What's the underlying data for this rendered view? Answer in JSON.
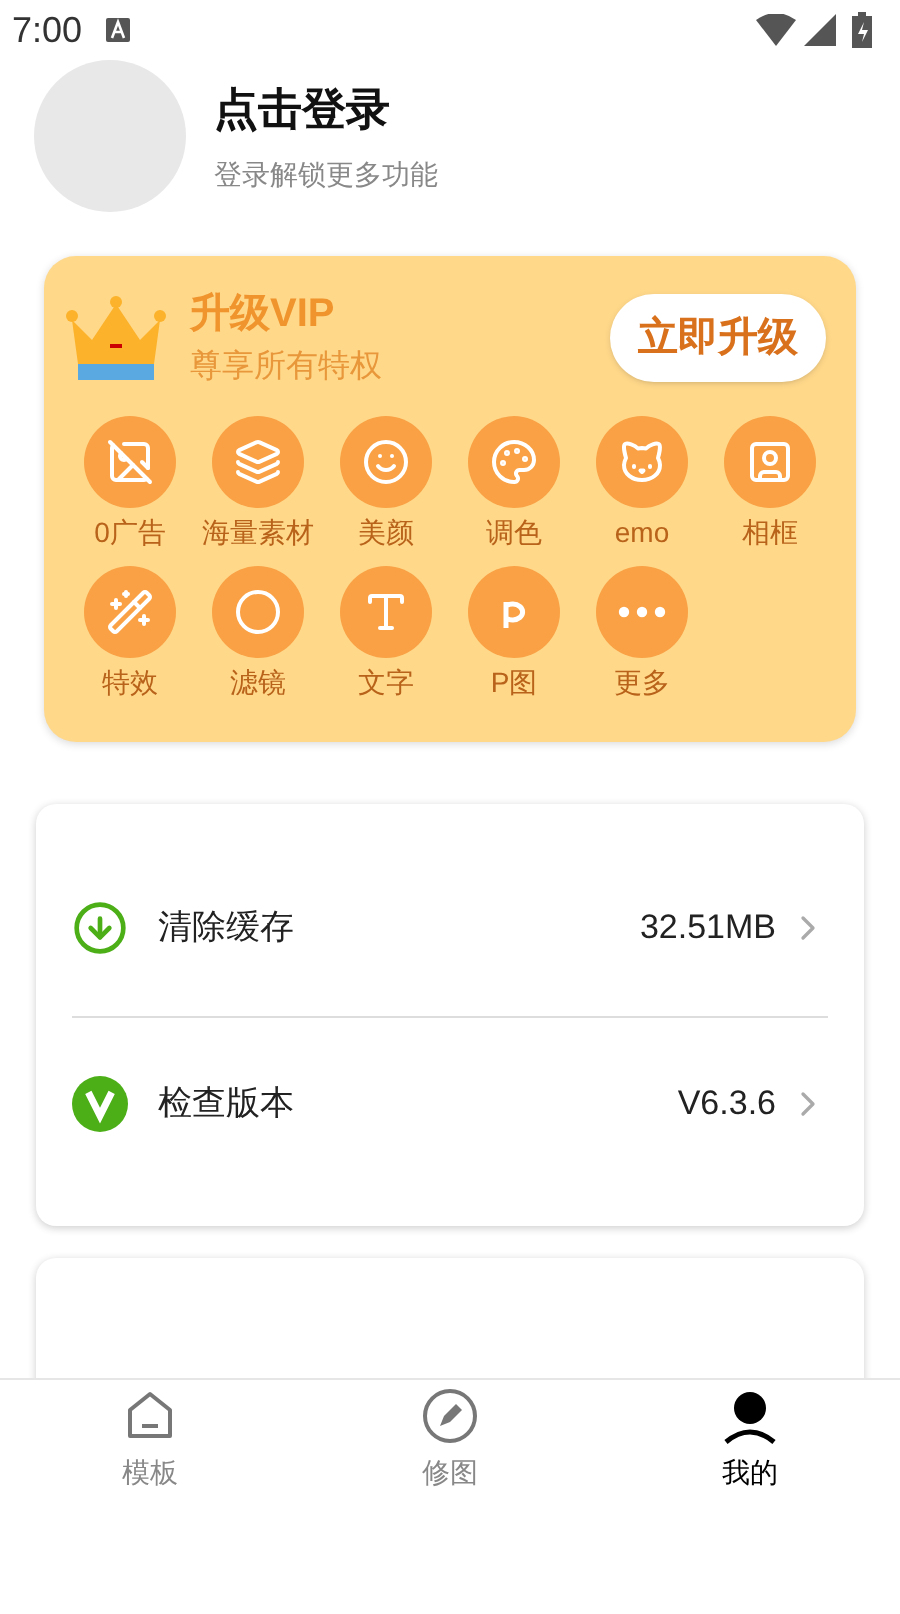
{
  "status_bar": {
    "time": "7:00"
  },
  "profile": {
    "title": "点击登录",
    "subtitle": "登录解锁更多功能"
  },
  "vip": {
    "title": "升级VIP",
    "subtitle": "尊享所有特权",
    "button": "立即升级",
    "features": [
      {
        "kind": "no-ads",
        "label": "0广告"
      },
      {
        "kind": "layers",
        "label": "海量素材"
      },
      {
        "kind": "face",
        "label": "美颜"
      },
      {
        "kind": "palette",
        "label": "调色"
      },
      {
        "kind": "emo",
        "label": "emo"
      },
      {
        "kind": "frame",
        "label": "相框"
      },
      {
        "kind": "wand",
        "label": "特效"
      },
      {
        "kind": "filter",
        "label": "滤镜"
      },
      {
        "kind": "text",
        "label": "文字"
      },
      {
        "kind": "p",
        "label": "P图"
      },
      {
        "kind": "more",
        "label": "更多"
      }
    ]
  },
  "settings": [
    {
      "kind": "download",
      "label": "清除缓存",
      "value": "32.51MB"
    },
    {
      "kind": "version",
      "label": "检查版本",
      "value": "V6.3.6"
    }
  ],
  "tabs": [
    {
      "kind": "home",
      "label": "模板",
      "selected": false
    },
    {
      "kind": "edit",
      "label": "修图",
      "selected": false
    },
    {
      "kind": "user",
      "label": "我的",
      "selected": true
    }
  ]
}
